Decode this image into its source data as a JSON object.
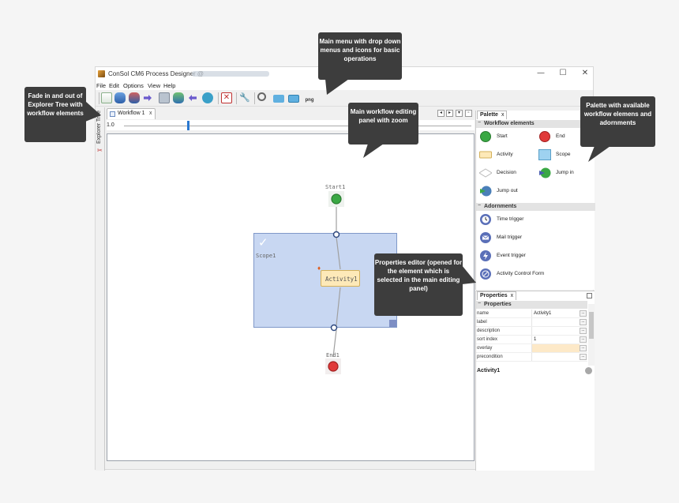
{
  "window": {
    "title": "ConSol CM6 Process Designer @",
    "minimize": "—",
    "maximize": "☐",
    "close": "✕"
  },
  "menu": [
    "File",
    "Edit",
    "Options",
    "View",
    "Help"
  ],
  "explorer": {
    "label": "Explorer Tree"
  },
  "editor": {
    "tab_label": "Workflow 1",
    "tab_close": "x",
    "zoom_value": "1.0",
    "nodes": {
      "start": "Start1",
      "scope": "Scope1",
      "activity": "Activity1",
      "end": "End1"
    }
  },
  "palette": {
    "tab_label": "Palette",
    "tab_close": "x",
    "sections": {
      "workflow_elements": "Workflow elements",
      "adornments": "Adornments"
    },
    "workflow_items": [
      "Start",
      "End",
      "Activity",
      "Scope",
      "Decision",
      "Jump in",
      "Jump out"
    ],
    "adornment_items": [
      "Time trigger",
      "Mail trigger",
      "Event trigger",
      "Activity Control Form"
    ]
  },
  "properties": {
    "tab_label": "Properties",
    "tab_close": "x",
    "section": "Properties",
    "rows": [
      {
        "key": "name",
        "value": "Activity1"
      },
      {
        "key": "label",
        "value": ""
      },
      {
        "key": "description",
        "value": ""
      },
      {
        "key": "sort index",
        "value": "1"
      },
      {
        "key": "overlay",
        "value": ""
      },
      {
        "key": "precondition",
        "value": ""
      }
    ],
    "row_button": "...",
    "selected_element": "Activity1"
  },
  "callouts": {
    "main_menu": "Main menu with drop down menus and icons for basic operations",
    "explorer": "Fade in and out of Explorer Tree with workflow elements",
    "editing_panel": "Main workflow editing panel with zoom",
    "palette": "Palette with available workflow elemens and adornments",
    "properties": "Properties editor (opened for the element which is selected in the main editing panel)"
  },
  "colors": {
    "callout_bg": "#3d3d3d",
    "scope_fill": "#c8d7f2",
    "activity_fill": "#fde9b8",
    "start_green": "#3aa844",
    "end_red": "#e03a3a",
    "accent_blue": "#2a78d0"
  }
}
